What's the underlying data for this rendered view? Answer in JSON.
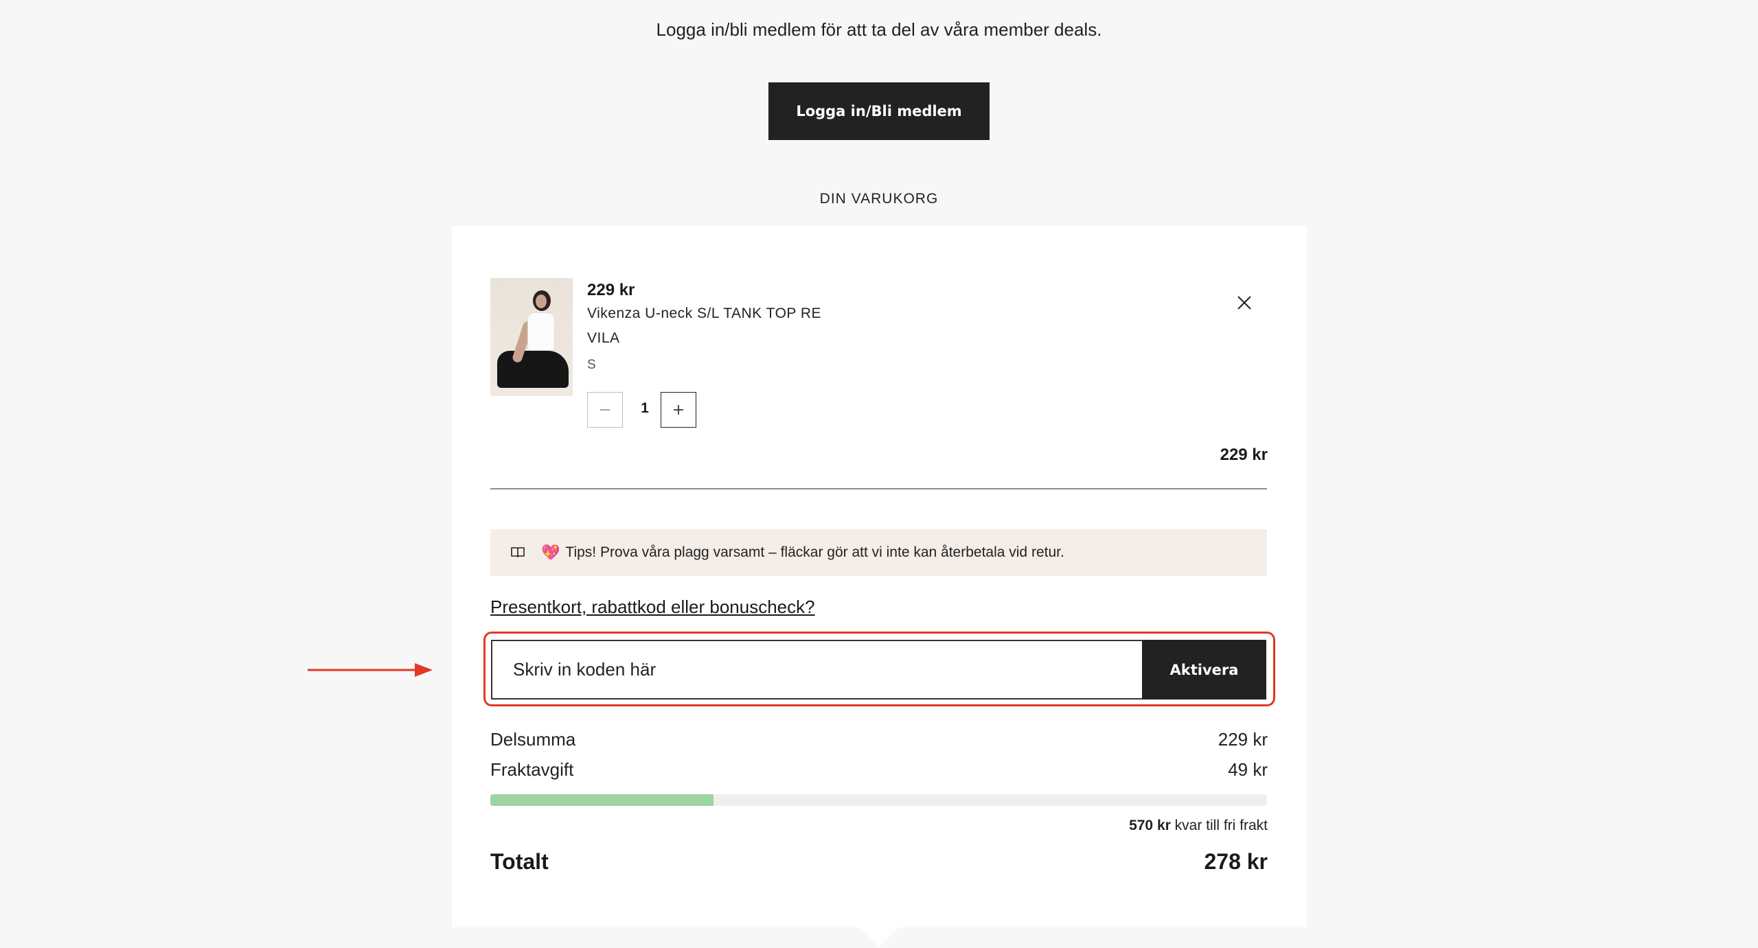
{
  "banner": {
    "member_text": "Logga in/bli medlem för att ta del av våra member deals.",
    "login_button": "Logga in/Bli medlem"
  },
  "cart": {
    "heading": "DIN VARUKORG",
    "item": {
      "price": "229 kr",
      "name": "Vikenza U-neck S/L TANK TOP RE",
      "brand": "VILA",
      "size": "S",
      "quantity": "1",
      "line_total": "229 kr",
      "image_icon": "product-photo"
    },
    "tip": {
      "emoji": "💖",
      "text": "Tips! Prova våra plagg varsamt – fläckar gör att vi inte kan återbetala vid retur."
    },
    "code_link": "Presentkort, rabattkod eller bonuscheck?",
    "code_input": {
      "placeholder": "Skriv in koden här",
      "value": ""
    },
    "activate_button": "Aktivera",
    "summary": {
      "subtotal_label": "Delsumma",
      "subtotal_value": "229 kr",
      "shipping_label": "Fraktavgift",
      "shipping_value": "49 kr",
      "free_shipping_progress_fraction": 0.287,
      "free_shipping_amount": "570 kr",
      "free_shipping_text": " kvar till fri frakt",
      "total_label": "Totalt",
      "total_value": "278 kr"
    }
  },
  "colors": {
    "button_bg": "#222222",
    "highlight": "#e03a22",
    "progress": "#9ed3a4",
    "tip_bg": "#f4ede8"
  }
}
